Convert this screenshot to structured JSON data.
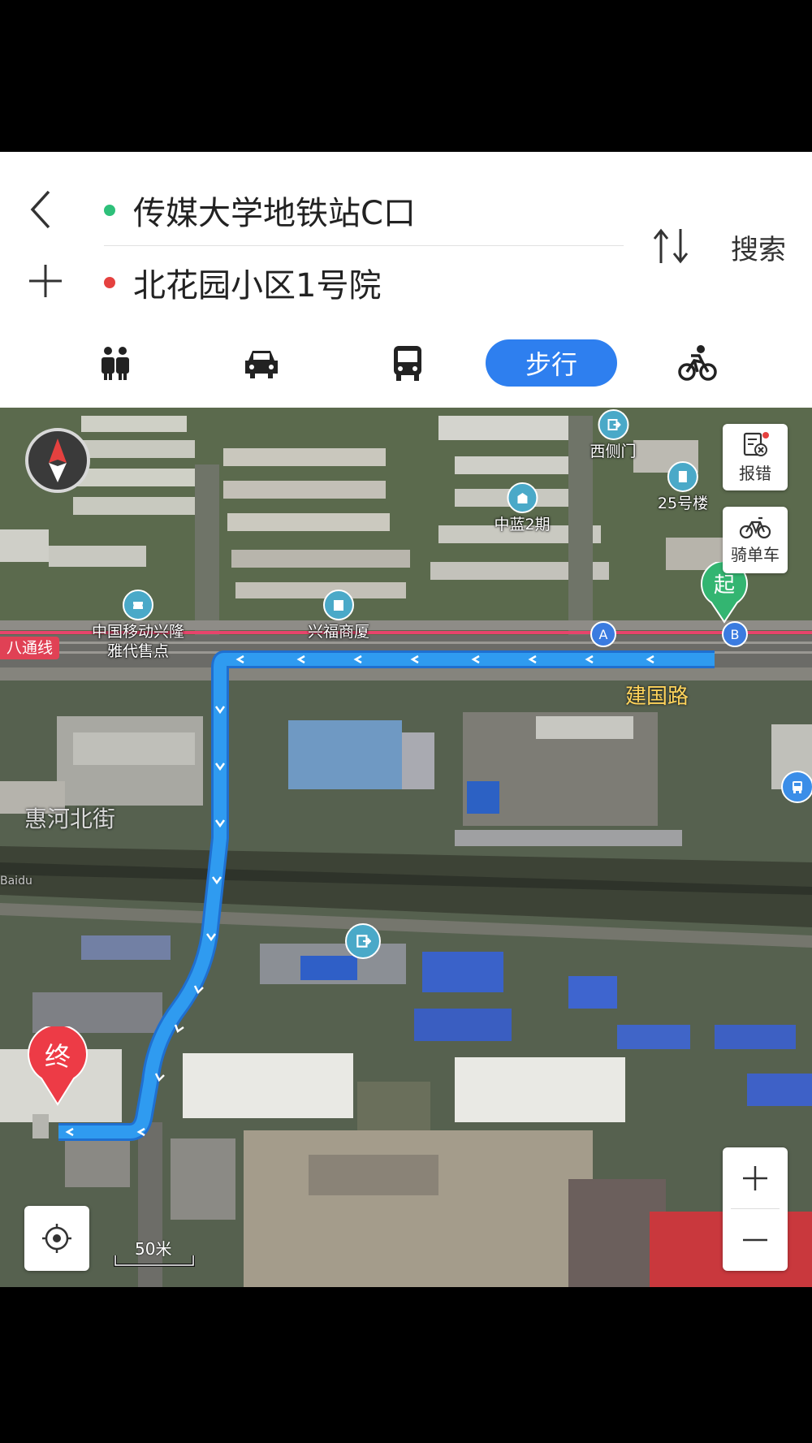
{
  "nav": {
    "origin": "传媒大学地铁站C口",
    "destination": "北花园小区1号院",
    "search_label": "搜索",
    "origin_dot_color": "#2ec07a",
    "dest_dot_color": "#e5413f"
  },
  "modes": [
    {
      "icon": "taxi-icon",
      "label": ""
    },
    {
      "icon": "car-icon",
      "label": ""
    },
    {
      "icon": "bus-icon",
      "label": ""
    },
    {
      "icon": "walk-mode",
      "label": "步行",
      "active": true
    },
    {
      "icon": "bicycle-icon",
      "label": ""
    }
  ],
  "map": {
    "side_buttons": {
      "report": "报错",
      "bike": "骑单车"
    },
    "pois": [
      {
        "name": "西侧门",
        "icon": "gate-icon"
      },
      {
        "name": "中蓝2期",
        "icon": "building-icon"
      },
      {
        "name": "25号楼",
        "icon": "building-icon"
      },
      {
        "name": "中国移动兴隆\n雅代售点",
        "icon": "ticket-icon"
      },
      {
        "name": "兴福商厦",
        "icon": "building-icon"
      }
    ],
    "station_badges": [
      "A",
      "B"
    ],
    "rail_line": "八通线",
    "roads": [
      "建国路",
      "惠河北街"
    ],
    "start_marker": "起",
    "end_marker": "终",
    "watermark": "Baidu",
    "scale": "50米",
    "route_color": "#2f9bf0",
    "zoom_in": "+",
    "zoom_out": "—"
  }
}
